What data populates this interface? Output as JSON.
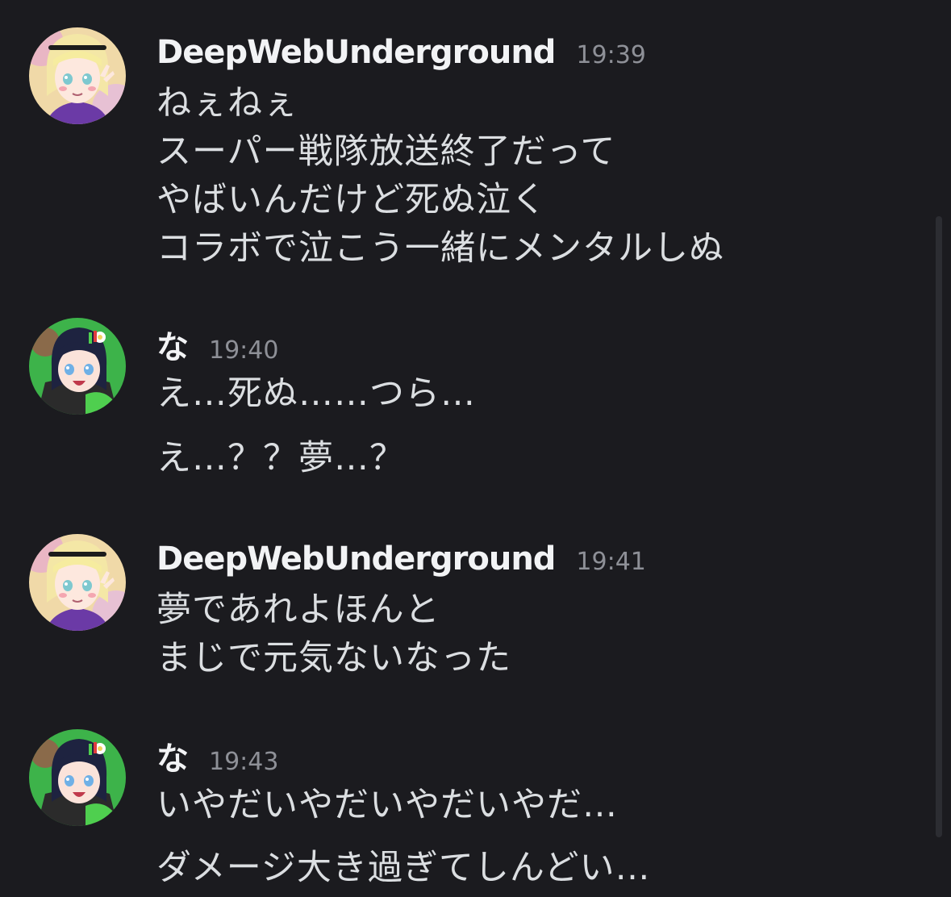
{
  "messages": [
    {
      "username": "DeepWebUnderground",
      "timestamp": "19:39",
      "avatar": "blonde-character-avatar",
      "lines": [
        "ねぇねぇ",
        "スーパー戦隊放送終了だって",
        "やばいんだけど死ぬ泣く",
        "コラボで泣こう一緒にメンタルしぬ"
      ]
    },
    {
      "username": "な",
      "timestamp": "19:40",
      "avatar": "dark-hair-character-avatar",
      "lines": [
        "え…死ぬ……つら…",
        "え…？？夢…？"
      ]
    },
    {
      "username": "DeepWebUnderground",
      "timestamp": "19:41",
      "avatar": "blonde-character-avatar",
      "lines": [
        "夢であれよほんと",
        "まじで元気ないなった"
      ]
    },
    {
      "username": "な",
      "timestamp": "19:43",
      "avatar": "dark-hair-character-avatar",
      "lines": [
        "いやだいやだいやだいやだ…",
        "ダメージ大き過ぎてしんどい…"
      ]
    }
  ],
  "colors": {
    "background": "#1b1b1f",
    "username": "#f2f3f5",
    "timestamp": "#8e9097",
    "message_text": "#dbdee1"
  }
}
